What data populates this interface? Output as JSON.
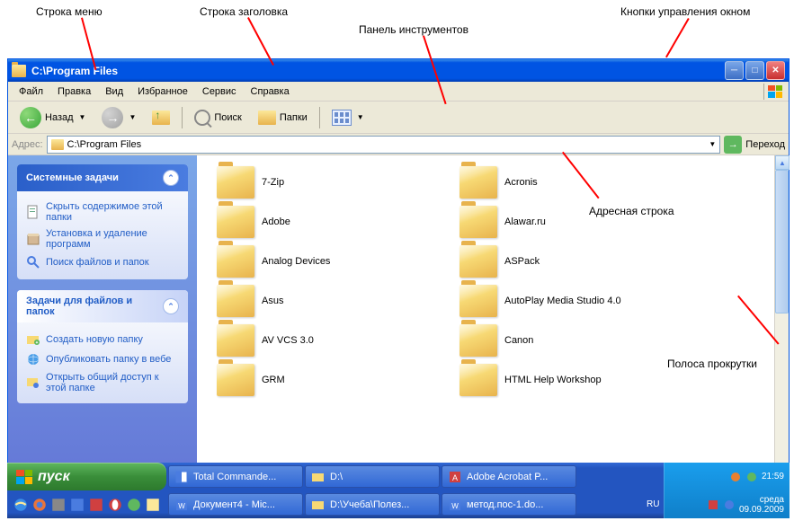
{
  "annotations": {
    "menu_row": "Строка меню",
    "title_row": "Строка заголовка",
    "toolbar": "Панель инструментов",
    "win_buttons": "Кнопки управления окном",
    "address_bar": "Адресная строка",
    "scrollbar": "Полоса прокрутки"
  },
  "window": {
    "title": "C:\\Program Files"
  },
  "menu": {
    "file": "Файл",
    "edit": "Правка",
    "view": "Вид",
    "favorites": "Избранное",
    "tools": "Сервис",
    "help": "Справка"
  },
  "toolbar_labels": {
    "back": "Назад",
    "search": "Поиск",
    "folders": "Папки"
  },
  "address": {
    "label": "Адрес:",
    "value": "C:\\Program Files",
    "go": "Переход"
  },
  "sidebar": {
    "system_tasks": {
      "title": "Системные задачи",
      "hide": "Скрыть содержимое этой папки",
      "install": "Установка и удаление программ",
      "search": "Поиск файлов и папок"
    },
    "file_tasks": {
      "title": "Задачи для файлов и папок",
      "new_folder": "Создать новую папку",
      "publish": "Опубликовать папку в вебе",
      "share": "Открыть общий доступ к этой папке"
    }
  },
  "folders": [
    {
      "name": "7-Zip"
    },
    {
      "name": "Acronis"
    },
    {
      "name": "Adobe"
    },
    {
      "name": "Alawar.ru"
    },
    {
      "name": "Analog Devices"
    },
    {
      "name": "ASPack"
    },
    {
      "name": "Asus"
    },
    {
      "name": "AutoPlay Media Studio 4.0"
    },
    {
      "name": "AV VCS 3.0"
    },
    {
      "name": "Canon"
    },
    {
      "name": "GRM"
    },
    {
      "name": "HTML Help Workshop"
    }
  ],
  "taskbar": {
    "start": "пуск",
    "lang": "RU",
    "tasks_top": [
      "Total Commande...",
      "D:\\",
      "Adobe Acrobat P..."
    ],
    "tasks_bottom": [
      "Документ4 - Mic...",
      "D:\\Учеба\\Полез...",
      "метод.пос-1.do..."
    ],
    "time": "21:59",
    "day": "среда",
    "date": "09.09.2009"
  }
}
